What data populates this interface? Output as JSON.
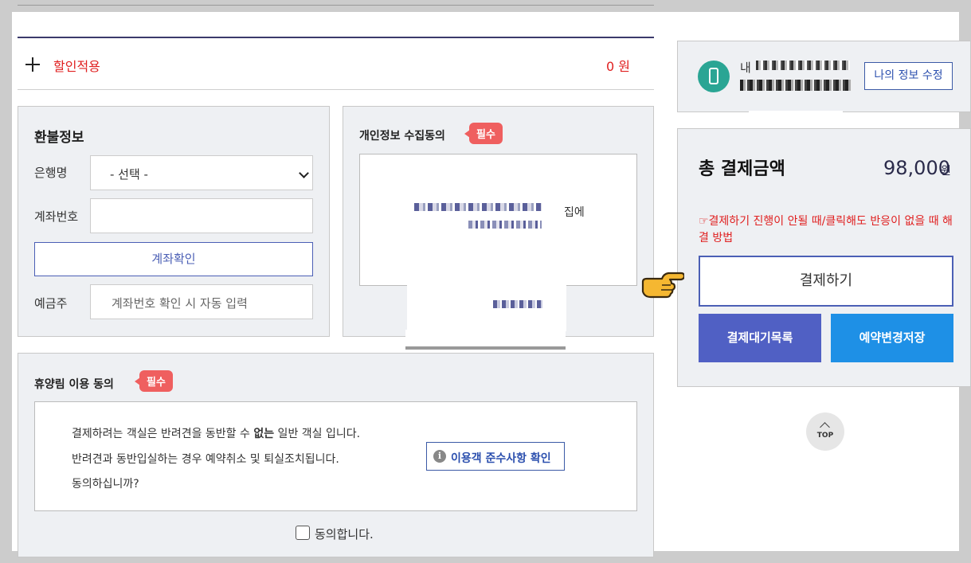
{
  "discount": {
    "label": "할인적용",
    "amount": "0 원"
  },
  "refund": {
    "title": "환불정보",
    "bank_label": "은행명",
    "bank_select": "- 선택 -",
    "account_label": "계좌번호",
    "account_value": "",
    "verify_button": "계좌확인",
    "holder_label": "예금주",
    "holder_placeholder": "계좌번호 확인 시 자동 입력"
  },
  "privacy": {
    "title": "개인정보 수집동의",
    "badge": "필수",
    "text_tail": "집에"
  },
  "usage": {
    "title": "휴양림 이용 동의",
    "badge": "필수",
    "line1_pre": "결제하려는 객실은 반려견을 동반할 수 ",
    "line1_bold": "없는",
    "line1_post": " 일반 객실 입니다.",
    "line2": "반려견과 동반입실하는 경우 예약취소 및 퇴실조치됩니다.",
    "line3": "동의하십니까?",
    "rules_button": "이용객 준수사항 확인",
    "agree_label": "동의합니다."
  },
  "user": {
    "prefix": "내",
    "edit_button": "나의 정보 수정"
  },
  "payment": {
    "total_label": "총 결제금액",
    "total_amount": "98,000",
    "unit": "원",
    "help_link": "☞결제하기 진행이 안될 때/클릭해도 반응이 없을 때 해결 방법",
    "pay_button": "결제하기",
    "wait_list_button": "결제대기목록",
    "save_change_button": "예약변경저장"
  },
  "top_button": "TOP",
  "icons": [
    "plus-icon",
    "chevron-down-icon",
    "info-icon",
    "phone-icon",
    "pointing-hand-icon",
    "arrow-up-icon"
  ],
  "colors": {
    "accent_red": "#e02020",
    "badge_red": "#ef5f5f",
    "brand_blue": "#4b5fb5",
    "wait_btn": "#5060c4",
    "save_btn": "#1e90e6",
    "phone_teal": "#2aa594"
  }
}
